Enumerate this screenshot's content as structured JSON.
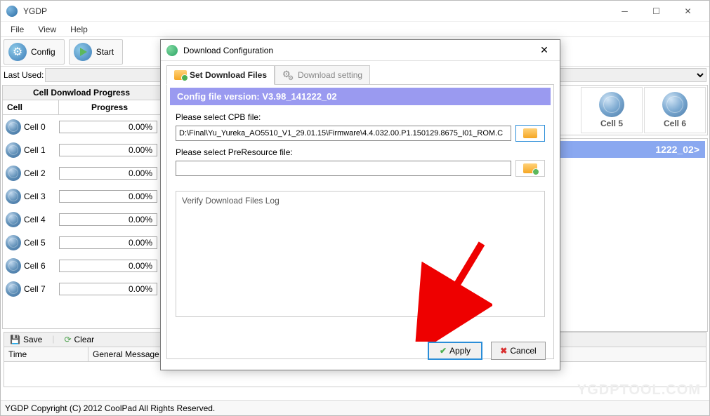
{
  "app": {
    "title": "YGDP"
  },
  "menu": {
    "file": "File",
    "view": "View",
    "help": "Help"
  },
  "toolbar": {
    "config": "Config",
    "start": "Start"
  },
  "lastUsed": {
    "label": "Last Used:",
    "value": ""
  },
  "progressPanel": {
    "header": "Cell Donwload Progress",
    "colCell": "Cell",
    "colProgress": "Progress",
    "rows": [
      {
        "name": "Cell 0",
        "pct": "0.00%"
      },
      {
        "name": "Cell 1",
        "pct": "0.00%"
      },
      {
        "name": "Cell 2",
        "pct": "0.00%"
      },
      {
        "name": "Cell 3",
        "pct": "0.00%"
      },
      {
        "name": "Cell 4",
        "pct": "0.00%"
      },
      {
        "name": "Cell 5",
        "pct": "0.00%"
      },
      {
        "name": "Cell 6",
        "pct": "0.00%"
      },
      {
        "name": "Cell 7",
        "pct": "0.00%"
      }
    ]
  },
  "rightCells": {
    "c5": "Cell 5",
    "c6": "Cell 6"
  },
  "infoBanner": "1222_02>",
  "dialog": {
    "title": "Download Configuration",
    "tabFiles": "Set Download Files",
    "tabSetting": "Download setting",
    "configVersion": "Config file version: V3.98_141222_02",
    "labelCpb": "Please select CPB file:",
    "cpbPath": "D:\\Final\\Yu_Yureka_AO5510_V1_29.01.15\\Firmware\\4.4.032.00.P1.150129.8675_I01_ROM.C",
    "labelPre": "Please select PreResource file:",
    "prePath": "",
    "verifyLabel": "Verify Download Files Log",
    "apply": "Apply",
    "cancel": "Cancel"
  },
  "log": {
    "save": "Save",
    "clear": "Clear",
    "colTime": "Time",
    "colMsg": "General Message"
  },
  "watermark": "YGDPTOOL.COM",
  "status": "YGDP Copyright (C) 2012 CoolPad All Rights Reserved."
}
